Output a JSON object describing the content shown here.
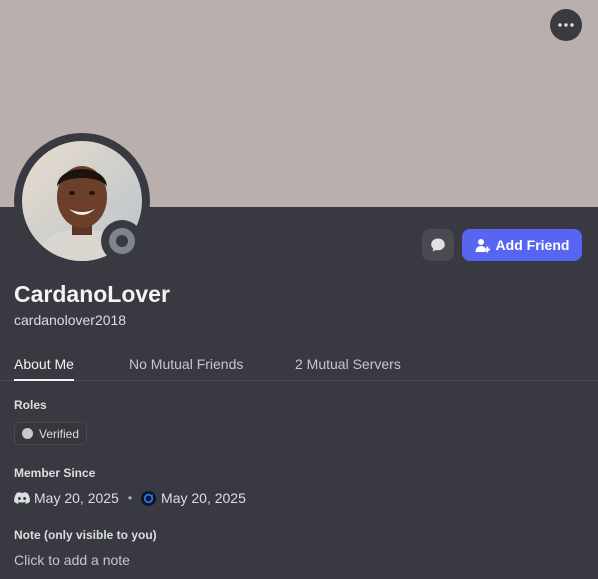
{
  "profile": {
    "display_name": "CardanoLover",
    "username": "cardanolover2018"
  },
  "actions": {
    "add_friend_label": "Add Friend"
  },
  "tabs": [
    {
      "label": "About Me",
      "active": true
    },
    {
      "label": "No Mutual Friends",
      "active": false
    },
    {
      "label": "2 Mutual Servers",
      "active": false
    }
  ],
  "roles": {
    "label": "Roles",
    "items": [
      {
        "name": "Verified"
      }
    ]
  },
  "member_since": {
    "label": "Member Since",
    "discord_date": "May 20, 2025",
    "server_date": "May 20, 2025"
  },
  "note": {
    "label": "Note (only visible to you)",
    "placeholder": "Click to add a note"
  },
  "colors": {
    "banner": "#b9afad",
    "card_background": "#393a41",
    "accent": "#5865f2",
    "status_offline": "#80848e"
  },
  "icons": {
    "more": "more-horizontal-icon",
    "message": "chat-bubble-icon",
    "add_friend": "add-user-icon",
    "discord": "discord-logo-icon",
    "server": "server-icon"
  },
  "status": "offline"
}
